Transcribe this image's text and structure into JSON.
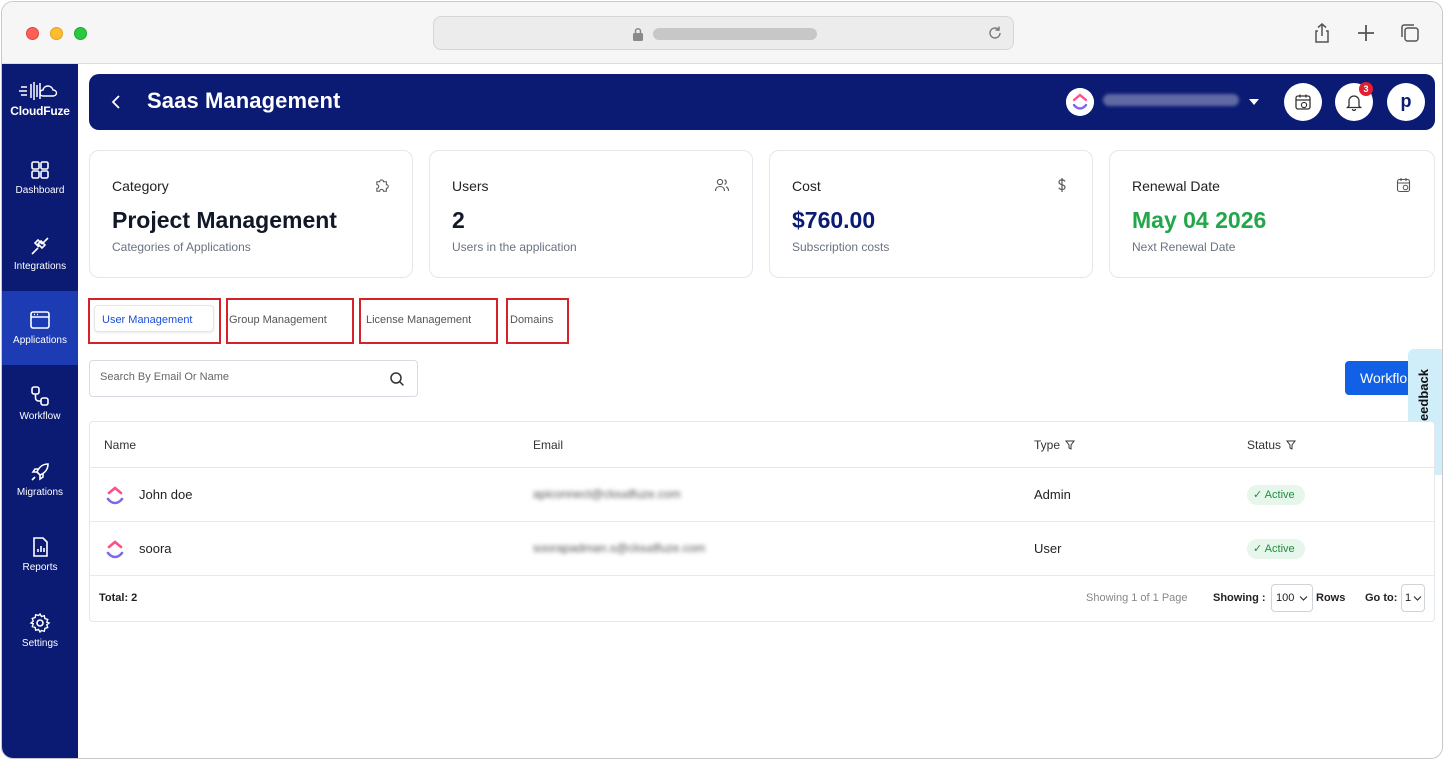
{
  "sidebar": {
    "brand": "CloudFuze",
    "items": [
      {
        "label": "Dashboard",
        "icon": "dashboard-icon"
      },
      {
        "label": "Integrations",
        "icon": "plug-icon"
      },
      {
        "label": "Applications",
        "icon": "window-icon",
        "active": true
      },
      {
        "label": "Workflow",
        "icon": "workflow-icon"
      },
      {
        "label": "Migrations",
        "icon": "rocket-icon"
      },
      {
        "label": "Reports",
        "icon": "report-icon"
      },
      {
        "label": "Settings",
        "icon": "gear-icon"
      }
    ]
  },
  "header": {
    "title": "Saas Management",
    "notification_count": "3",
    "avatar_initial": "p"
  },
  "cards": {
    "category": {
      "label": "Category",
      "value": "Project Management",
      "sub": "Categories of Applications"
    },
    "users": {
      "label": "Users",
      "value": "2",
      "sub": "Users in the application"
    },
    "cost": {
      "label": "Cost",
      "value": "$760.00",
      "sub": "Subscription costs"
    },
    "renewal": {
      "label": "Renewal Date",
      "value": "May 04 2026",
      "sub": "Next Renewal Date"
    }
  },
  "tabs": [
    {
      "label": "User Management",
      "active": true
    },
    {
      "label": "Group Management"
    },
    {
      "label": "License Management"
    },
    {
      "label": "Domains"
    }
  ],
  "search": {
    "placeholder": "Search By Email Or Name"
  },
  "workflow_button": "Workflo",
  "feedback_label": "Feedback",
  "table": {
    "columns": {
      "name": "Name",
      "email": "Email",
      "type": "Type",
      "status": "Status"
    },
    "rows": [
      {
        "name": "John doe",
        "email": "apiconnect@cloudfuze.com",
        "type": "Admin",
        "status": "Active"
      },
      {
        "name": "soora",
        "email": "soorapadman.s@cloudfuze.com",
        "type": "User",
        "status": "Active"
      }
    ],
    "footer": {
      "total": "Total: 2",
      "pages": "Showing 1 of 1 Page",
      "showing_label": "Showing :",
      "rows_value": "100",
      "rows_label": "Rows",
      "goto_label": "Go to:",
      "goto_value": "1"
    }
  },
  "colors": {
    "sidebar": "#0b1a73",
    "active_nav": "#1d3bb3",
    "primary_button": "#1260e6",
    "renewal_green": "#22a74a",
    "tab_outline": "#d3222a"
  }
}
